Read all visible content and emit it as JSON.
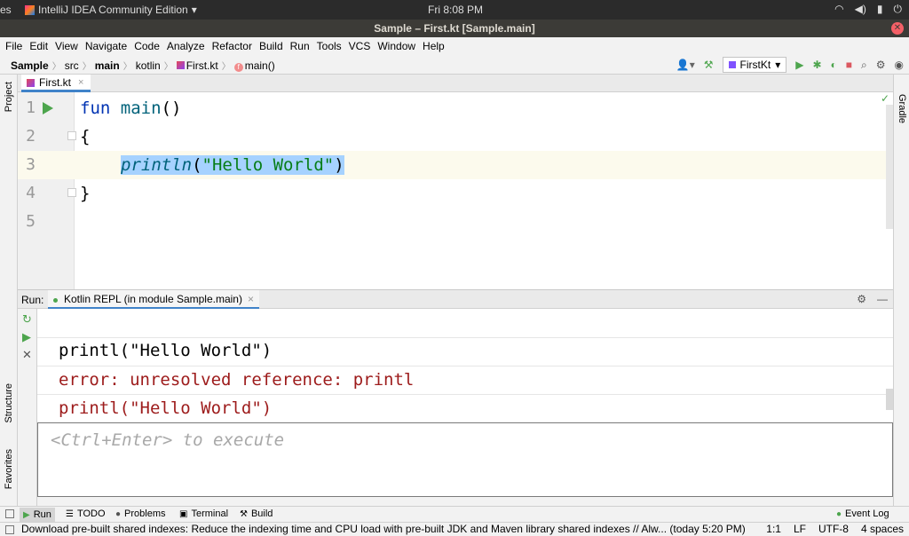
{
  "topbar": {
    "activities": "es",
    "app_name": "IntelliJ IDEA Community Edition",
    "app_menu_arrow": "▾",
    "clock": "Fri  8:08 PM",
    "tray_icons": [
      "wifi-icon",
      "volume-icon",
      "battery-icon",
      "power-icon"
    ]
  },
  "window": {
    "title": "Sample – First.kt [Sample.main]",
    "close_glyph": "✕"
  },
  "menu": [
    "File",
    "Edit",
    "View",
    "Navigate",
    "Code",
    "Analyze",
    "Refactor",
    "Build",
    "Run",
    "Tools",
    "VCS",
    "Window",
    "Help"
  ],
  "breadcrumb": {
    "items": [
      "Sample",
      "src",
      "main",
      "kotlin",
      "First.kt",
      "main()"
    ],
    "function_badge": "f"
  },
  "run_config": {
    "label": "FirstKt",
    "arrow": "▾"
  },
  "toolbar_icons": [
    "add-user-icon",
    "hammer-icon",
    "run-icon",
    "debug-icon",
    "coverage-icon",
    "stop-icon",
    "search-icon",
    "settings-icon",
    "profile-icon"
  ],
  "left_stripe": {
    "project": "Project",
    "structure": "Structure",
    "favorites": "Favorites"
  },
  "right_stripe": {
    "gradle": "Gradle"
  },
  "editor": {
    "tab_label": "First.kt",
    "tab_close": "×",
    "line_numbers": [
      "1",
      "2",
      "3",
      "4",
      "5"
    ],
    "lines": {
      "l1_kw": "fun",
      "l1_fn": "main",
      "l1_rest": "()",
      "l2": "{",
      "l3_call": "println",
      "l3_open": "(",
      "l3_str": "\"Hello World\"",
      "l3_close": ")",
      "l4": "}"
    },
    "inspection_ok": "✓"
  },
  "run_panel": {
    "label": "Run:",
    "tab_label": "Kotlin REPL (in module Sample.main)",
    "tab_close": "×",
    "tools": [
      "⚙",
      "—"
    ],
    "side_buttons": [
      "↻",
      "▶",
      "✕"
    ],
    "console_lines": [
      "printl(\"Hello World\")",
      "error: unresolved reference: printl",
      "printl(\"Hello World\")"
    ],
    "input_placeholder": "<Ctrl+Enter> to execute"
  },
  "bottom_tools": [
    {
      "label": "Run",
      "icon": "▶"
    },
    {
      "label": "TODO",
      "icon": "☰"
    },
    {
      "label": "Problems",
      "icon": "●"
    },
    {
      "label": "Terminal",
      "icon": "▣"
    },
    {
      "label": "Build",
      "icon": "⚒"
    }
  ],
  "event_log": {
    "label": "Event Log",
    "icon": "●"
  },
  "status": {
    "message": "Download pre-built shared indexes: Reduce the indexing time and CPU load with pre-built JDK and Maven library shared indexes // Alw... (today 5:20 PM)",
    "position": "1:1",
    "line_ending": "LF",
    "encoding": "UTF-8",
    "indent": "4 spaces"
  },
  "colors": {
    "keyword": "#0033b3",
    "function": "#00627a",
    "string": "#067d17",
    "error": "#9d1b1b",
    "selection": "#a6d2ff",
    "run_green": "#4da54d",
    "stop_red": "#db5860"
  }
}
